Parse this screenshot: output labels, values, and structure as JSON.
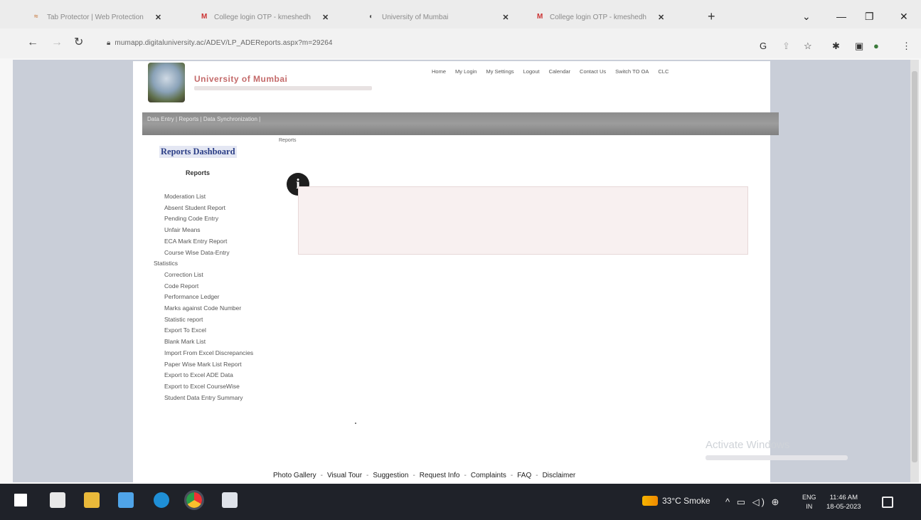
{
  "browser": {
    "tabs": [
      {
        "label": "Tab Protector | Web Protection"
      },
      {
        "label": "College login OTP - kmeshedh"
      },
      {
        "label": "University of Mumbai"
      },
      {
        "label": "College login OTP - kmeshedh"
      }
    ],
    "new_tab_label": "+",
    "url": "mumapp.digitaluniversity.ac/ADEV/LP_ADEReports.aspx?m=29264"
  },
  "site": {
    "title": "University of Mumbai",
    "top_nav": [
      "Home",
      "My Login",
      "My Settings",
      "Logout",
      "Calendar",
      "Contact Us",
      "Switch TO OA",
      "CLC"
    ],
    "menu_bar": "Data Entry | Reports | Data Synchronization |"
  },
  "sidebar": {
    "title": "Reports Dashboard",
    "heading": "Reports",
    "items": [
      {
        "label": "Moderation List",
        "kind": "item"
      },
      {
        "label": "Absent Student Report",
        "kind": "item"
      },
      {
        "label": "Pending Code Entry",
        "kind": "item"
      },
      {
        "label": "Unfair Means",
        "kind": "item"
      },
      {
        "label": "ECA Mark Entry Report",
        "kind": "item"
      },
      {
        "label": "Course Wise Data-Entry",
        "kind": "item"
      },
      {
        "label": "Statistics",
        "kind": "section"
      },
      {
        "label": "Correction List",
        "kind": "item"
      },
      {
        "label": "Code Report",
        "kind": "item"
      },
      {
        "label": "Performance Ledger",
        "kind": "item"
      },
      {
        "label": "Marks against Code Number",
        "kind": "wrap"
      },
      {
        "label": "Statistic report",
        "kind": "item"
      },
      {
        "label": "Export To Excel",
        "kind": "item"
      },
      {
        "label": "Blank Mark List",
        "kind": "item"
      },
      {
        "label": "Import From Excel Discrepancies",
        "kind": "wrap"
      },
      {
        "label": "Paper Wise Mark List Report",
        "kind": "wrap"
      },
      {
        "label": "Export to Excel ADE Data",
        "kind": "item"
      },
      {
        "label": "Export to Excel CourseWise",
        "kind": "wrap"
      },
      {
        "label": "Student Data Entry Summary",
        "kind": "wrap"
      }
    ]
  },
  "main": {
    "breadcrumb": "Reports",
    "info_icon_glyph": "i"
  },
  "watermark": "Activate Windows",
  "footer": {
    "links": [
      "Photo Gallery",
      "Visual Tour",
      "Suggestion",
      "Request Info",
      "Complaints",
      "FAQ",
      "Disclaimer"
    ]
  },
  "taskbar": {
    "weather": "33°C  Smoke",
    "lang_top": "ENG",
    "lang_bottom": "IN",
    "time": "11:46 AM",
    "date": "18-05-2023"
  },
  "colors": {
    "menu_bar": "#8d8d8d",
    "dashboard_title": "#2b3e86",
    "site_title": "#c46a6a",
    "taskbar": "#1f2229"
  }
}
